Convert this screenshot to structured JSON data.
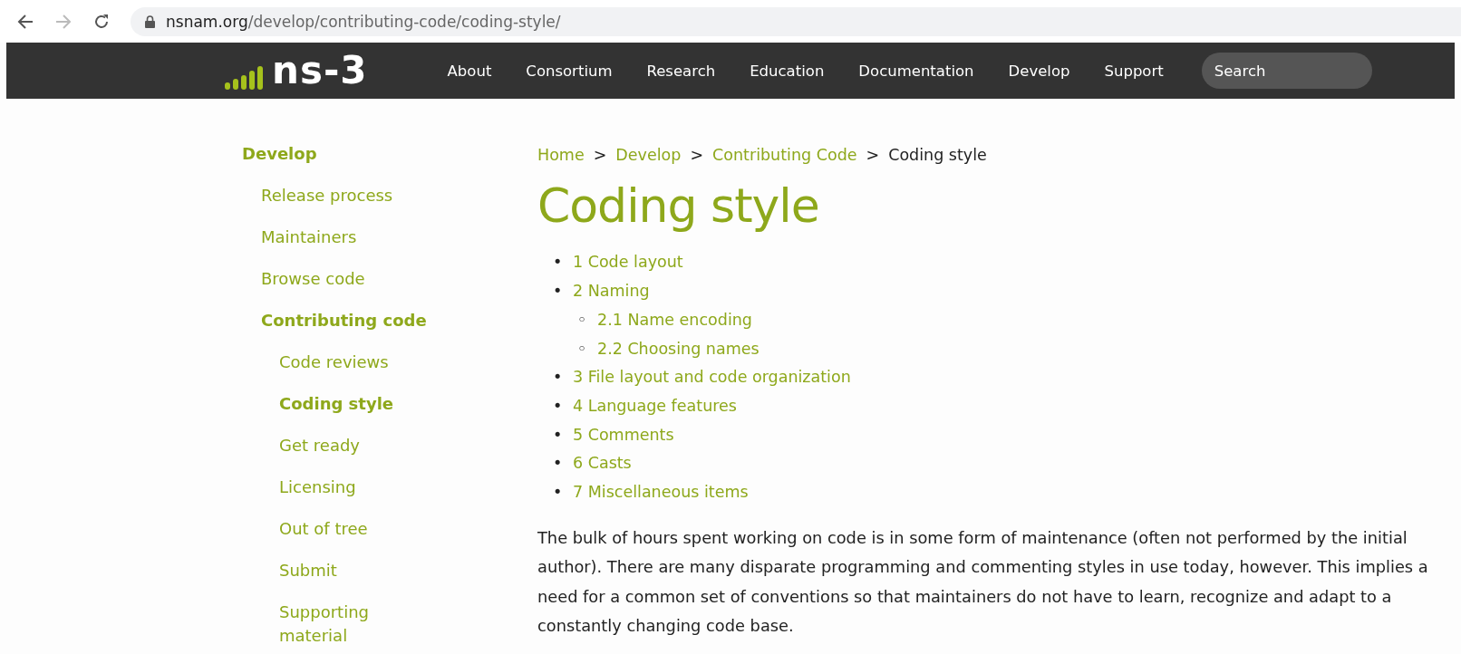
{
  "browser": {
    "back_disabled": false,
    "forward_disabled": true,
    "url_host": "nsnam.org",
    "url_path": "/develop/contributing-code/coding-style/"
  },
  "header": {
    "logo": "ns-3",
    "nav": [
      "About",
      "Consortium",
      "Research",
      "Education",
      "Documentation",
      "Develop",
      "Support"
    ],
    "search": {
      "placeholder": "Search"
    }
  },
  "sidebar": {
    "heading": "Develop",
    "items": [
      {
        "label": "Release process",
        "expanded": false
      },
      {
        "label": "Maintainers",
        "expanded": false
      },
      {
        "label": "Browse code",
        "expanded": false
      },
      {
        "label": "Contributing code",
        "expanded": true,
        "children": [
          {
            "label": "Code reviews",
            "selected": false
          },
          {
            "label": "Coding style",
            "selected": true
          },
          {
            "label": "Get ready",
            "selected": false
          },
          {
            "label": "Licensing",
            "selected": false
          },
          {
            "label": "Out of tree",
            "selected": false
          },
          {
            "label": "Submit",
            "selected": false
          },
          {
            "label": "Supporting material",
            "selected": false
          }
        ]
      }
    ]
  },
  "breadcrumb": [
    {
      "label": "Home",
      "current": false
    },
    {
      "label": "Develop",
      "current": false
    },
    {
      "label": "Contributing Code",
      "current": false
    },
    {
      "label": "Coding style",
      "current": true
    }
  ],
  "breadcrumb_separator": ">",
  "title": "Coding style",
  "toc": [
    {
      "marker": "•",
      "label": "1 Code layout"
    },
    {
      "marker": "•",
      "label": "2 Naming",
      "children": [
        {
          "marker": "◦",
          "label": "2.1 Name encoding"
        },
        {
          "marker": "◦",
          "label": "2.2 Choosing names"
        }
      ]
    },
    {
      "marker": "•",
      "label": "3 File layout and code organization"
    },
    {
      "marker": "•",
      "label": "4 Language features"
    },
    {
      "marker": "•",
      "label": "5 Comments"
    },
    {
      "marker": "•",
      "label": "6 Casts"
    },
    {
      "marker": "•",
      "label": "7 Miscellaneous items"
    }
  ],
  "paragraph": "The bulk of hours spent working on code is in some form of maintenance (often not performed by the initial author). There are many disparate programming and commenting styles in use today, however. This implies a need for a common set of conventions so that maintainers do not have to learn, recognize and adapt to a constantly changing code base."
}
